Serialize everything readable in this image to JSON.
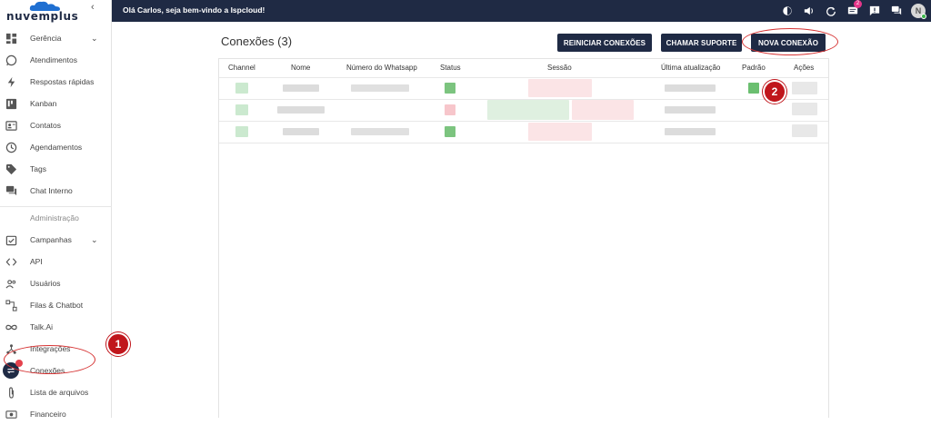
{
  "app": {
    "brand": "nuvemplus",
    "welcome": "Olá Carlos, seja bem-vindo a Ispcloud!",
    "notification_count": "2",
    "avatar_initial": "N",
    "colors": {
      "primary": "#1f2a44",
      "accent_red": "#c0161c",
      "online": "#3cb54a"
    }
  },
  "sidebar": {
    "items": [
      {
        "label": "Gerência",
        "icon": "dashboard-icon",
        "has_submenu": true
      },
      {
        "label": "Atendimentos",
        "icon": "whatsapp-icon"
      },
      {
        "label": "Respostas rápidas",
        "icon": "bolt-icon"
      },
      {
        "label": "Kanban",
        "icon": "kanban-icon"
      },
      {
        "label": "Contatos",
        "icon": "contact-card-icon"
      },
      {
        "label": "Agendamentos",
        "icon": "clock-icon"
      },
      {
        "label": "Tags",
        "icon": "tag-icon"
      },
      {
        "label": "Chat Interno",
        "icon": "chat-icon"
      }
    ],
    "admin_section": "Administração",
    "admin_items": [
      {
        "label": "Campanhas",
        "icon": "calendar-check-icon",
        "has_submenu": true
      },
      {
        "label": "API",
        "icon": "code-icon"
      },
      {
        "label": "Usuários",
        "icon": "users-icon"
      },
      {
        "label": "Filas & Chatbot",
        "icon": "flow-icon"
      },
      {
        "label": "Talk.Ai",
        "icon": "infinity-icon"
      },
      {
        "label": "Integrações",
        "icon": "hub-icon"
      },
      {
        "label": "Conexões",
        "icon": "connections-icon",
        "active": true
      },
      {
        "label": "Lista de arquivos",
        "icon": "paperclip-icon"
      },
      {
        "label": "Financeiro",
        "icon": "money-icon"
      }
    ]
  },
  "main": {
    "title": "Conexões (3)",
    "buttons": {
      "restart": "REINICIAR CONEXÕES",
      "support": "CHAMAR SUPORTE",
      "new": "NOVA CONEXÃO"
    },
    "table": {
      "headers": [
        "Channel",
        "Nome",
        "Número do Whatsapp",
        "Status",
        "Sessão",
        "Última atualização",
        "Padrão",
        "Ações"
      ]
    }
  },
  "annotations": {
    "step1": "1",
    "step2": "2"
  }
}
